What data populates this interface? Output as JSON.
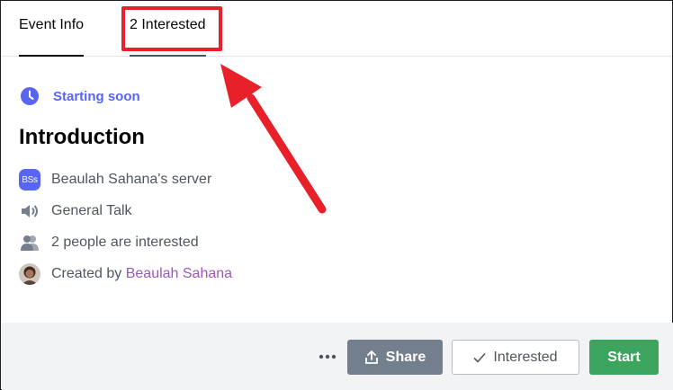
{
  "tabs": {
    "event_info": "Event Info",
    "interested": "2 Interested"
  },
  "event": {
    "status": "Starting soon",
    "title": "Introduction",
    "server_badge": "BSs",
    "server_name": "Beaulah Sahana's server",
    "channel": "General Talk",
    "interested_count": "2 people are interested",
    "created_by_prefix": "Created by",
    "creator": "Beaulah Sahana"
  },
  "footer": {
    "more": "•••",
    "share": "Share",
    "interested": "Interested",
    "start": "Start"
  },
  "colors": {
    "accent": "#5865f2",
    "start": "#3ba55d",
    "share": "#747f8d",
    "annotation": "#e8202a",
    "creator_link": "#9b59b6"
  },
  "icons": [
    "clock-icon",
    "speaker-icon",
    "people-icon",
    "more-icon",
    "share-icon",
    "check-icon",
    "arrow-annotation"
  ]
}
